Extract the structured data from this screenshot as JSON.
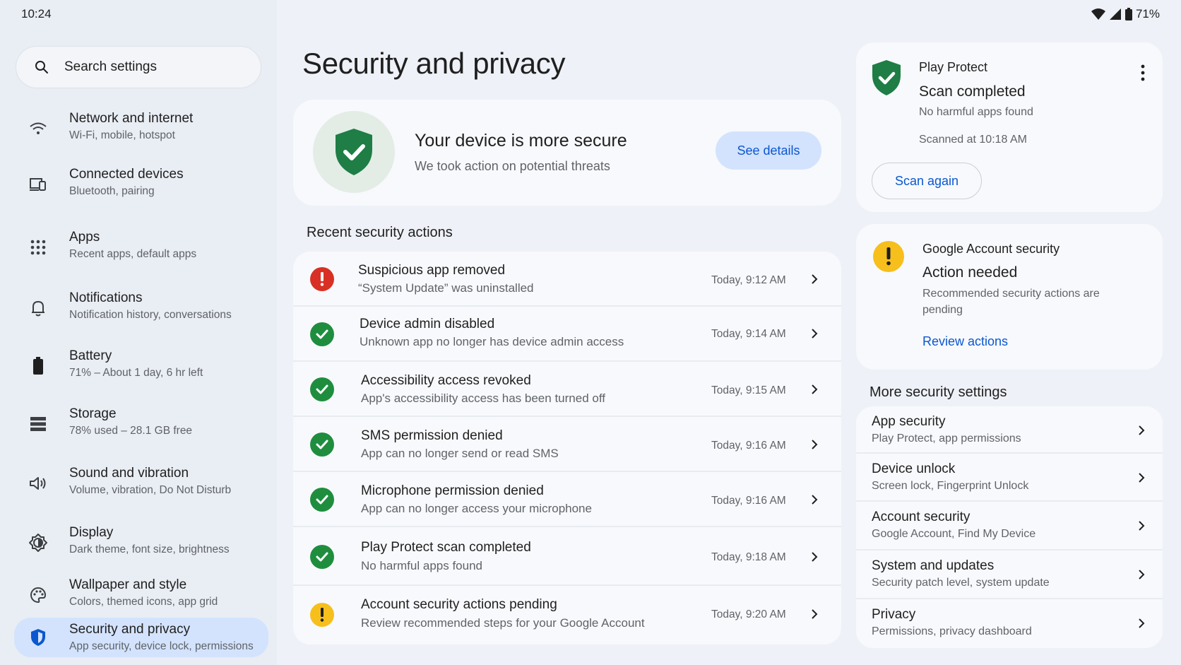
{
  "status_bar": {
    "time": "10:24",
    "battery": "71%",
    "icons": [
      "wifi-icon",
      "signal-icon",
      "battery-icon"
    ]
  },
  "search": {
    "placeholder": "Search settings"
  },
  "sidebar": {
    "items": [
      {
        "title": "Network and internet",
        "subtitle": "Wi-Fi, mobile, hotspot",
        "icon": "wifi-icon"
      },
      {
        "title": "Connected devices",
        "subtitle": "Bluetooth, pairing",
        "icon": "devices-icon"
      },
      {
        "title": "Apps",
        "subtitle": "Recent apps, default apps",
        "icon": "apps-grid-icon"
      },
      {
        "title": "Notifications",
        "subtitle": "Notification history, conversations",
        "icon": "bell-icon"
      },
      {
        "title": "Battery",
        "subtitle": "71% – About 1 day, 6 hr left",
        "icon": "battery-icon"
      },
      {
        "title": "Storage",
        "subtitle": "78% used – 28.1 GB free",
        "icon": "storage-icon"
      },
      {
        "title": "Sound and vibration",
        "subtitle": "Volume, vibration, Do Not Disturb",
        "icon": "volume-icon"
      },
      {
        "title": "Display",
        "subtitle": "Dark theme, font size, brightness",
        "icon": "brightness-icon"
      },
      {
        "title": "Wallpaper and style",
        "subtitle": "Colors, themed icons, app grid",
        "icon": "palette-icon"
      },
      {
        "title": "Security and privacy",
        "subtitle": "App security, device lock, permissions",
        "icon": "security-shield-icon",
        "active": true
      }
    ]
  },
  "main": {
    "title": "Security and privacy",
    "hero": {
      "title": "Your device is more secure",
      "subtitle": "We took action on potential threats",
      "button": "See details"
    },
    "recent_label": "Recent security actions",
    "actions": [
      {
        "title": "Suspicious app removed",
        "subtitle": "“System Update” was uninstalled",
        "time": "Today, 9:12 AM",
        "status": "error"
      },
      {
        "title": "Device admin disabled",
        "subtitle": "Unknown app no longer has device admin access",
        "time": "Today, 9:14 AM",
        "status": "ok"
      },
      {
        "title": "Accessibility access revoked",
        "subtitle": "App's accessibility access has been turned off",
        "time": "Today, 9:15 AM",
        "status": "ok"
      },
      {
        "title": "SMS permission denied",
        "subtitle": "App can no longer send or read SMS",
        "time": "Today, 9:16 AM",
        "status": "ok"
      },
      {
        "title": "Microphone permission denied",
        "subtitle": "App can no longer access your microphone",
        "time": "Today, 9:16 AM",
        "status": "ok"
      },
      {
        "title": "Play Protect scan completed",
        "subtitle": "No harmful apps found",
        "time": "Today, 9:18 AM",
        "status": "ok"
      },
      {
        "title": "Account security actions pending",
        "subtitle": "Review recommended steps for your Google Account",
        "time": "Today, 9:20 AM",
        "status": "warning"
      }
    ]
  },
  "play_protect": {
    "title": "Play Protect",
    "state": "Scan completed",
    "subtitle": "No harmful apps found",
    "scanned": "Scanned at 10:18 AM",
    "button": "Scan again"
  },
  "google_account": {
    "title": "Google Account security",
    "state": "Action needed",
    "subtitle": "Recommended security actions are pending",
    "link": "Review actions"
  },
  "more_settings": {
    "label": "More security settings",
    "items": [
      {
        "title": "App security",
        "subtitle": "Play Protect, app permissions"
      },
      {
        "title": "Device unlock",
        "subtitle": "Screen lock, Fingerprint Unlock"
      },
      {
        "title": "Account security",
        "subtitle": "Google Account, Find My Device"
      },
      {
        "title": "System and updates",
        "subtitle": "Security patch level, system update"
      },
      {
        "title": "Privacy",
        "subtitle": "Permissions, privacy dashboard"
      }
    ]
  },
  "colors": {
    "accent": "#0b57d0",
    "ok_green": "#1e8e3e",
    "error_red": "#d93025",
    "warning_yellow": "#f6bf1c",
    "active_nav": "#d3e3fd"
  }
}
